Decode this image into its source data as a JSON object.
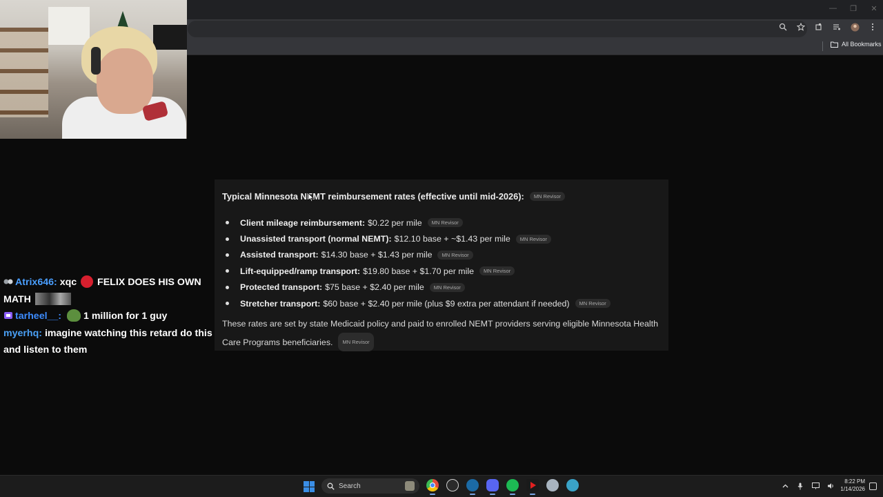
{
  "browser": {
    "bookmarks_label": "All Bookmarks",
    "icons": [
      "zoom-icon",
      "star-icon",
      "extensions-icon",
      "media-icon",
      "profile-icon",
      "menu-icon"
    ]
  },
  "window_controls": {
    "minimize": "—",
    "restore": "❐",
    "close": "✕"
  },
  "panel": {
    "title": "Typical Minnesota NEMT reimbursement rates (effective until mid-2026):",
    "source_badge": "MN Revisor",
    "rates": [
      {
        "label": "Client mileage reimbursement:",
        "value": "$0.22 per mile",
        "badge": "MN Revisor"
      },
      {
        "label": "Unassisted transport (normal NEMT):",
        "value": "$12.10 base + ~$1.43 per mile",
        "badge": "MN Revisor"
      },
      {
        "label": "Assisted transport:",
        "value": "$14.30 base + $1.43 per mile",
        "badge": "MN Revisor"
      },
      {
        "label": "Lift-equipped/ramp transport:",
        "value": "$19.80 base + $1.70 per mile",
        "badge": "MN Revisor"
      },
      {
        "label": "Protected transport:",
        "value": "$75 base + $2.40 per mile",
        "badge": "MN Revisor"
      },
      {
        "label": "Stretcher transport:",
        "value": "$60 base + $2.40 per mile (plus $9 extra per attendant if needed)",
        "badge": "MN Revisor"
      }
    ],
    "footer": "These rates are set by state Medicaid policy and paid to enrolled NEMT providers serving eligible Minnesota Health Care Programs beneficiaries.",
    "footer_badge": "MN Revisor"
  },
  "chat": {
    "messages": [
      {
        "name": "Atrix646:",
        "name_color": "#4a9fff",
        "text_a": "xqc",
        "text_b": "FELIX DOES HIS OWN MATH"
      },
      {
        "name": "tarheel__:",
        "name_color": "#3d8cff",
        "text": "1 million for 1 guy"
      },
      {
        "name": "myerhq:",
        "name_color": "#4aa0f5",
        "text": "imagine watching this retard do this and listen to them"
      }
    ]
  },
  "taskbar": {
    "search_placeholder": "Search",
    "apps": [
      {
        "name": "chrome-icon",
        "color": "#e34c3b",
        "active": true
      },
      {
        "name": "github-icon",
        "color": "#d0d0d0",
        "active": false
      },
      {
        "name": "steam-icon",
        "color": "#1b6aa5",
        "active": true
      },
      {
        "name": "discord-icon",
        "color": "#5865f2",
        "active": true
      },
      {
        "name": "spotify-icon",
        "color": "#1db954",
        "active": true
      },
      {
        "name": "media-player-icon",
        "color": "#e02020",
        "active": true
      },
      {
        "name": "settings-icon",
        "color": "#a8b4c0",
        "active": false
      },
      {
        "name": "browser-globe-icon",
        "color": "#3aa3c8",
        "active": false
      }
    ],
    "time": "8:22 PM",
    "date": "1/14/2026"
  }
}
